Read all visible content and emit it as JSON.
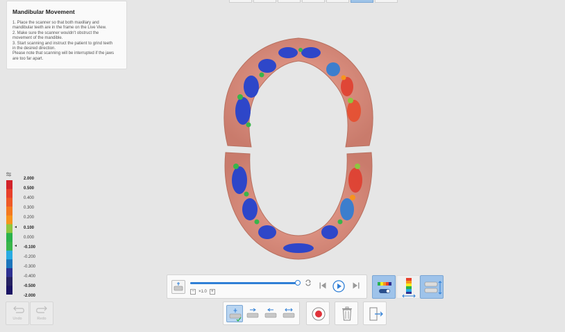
{
  "instructions": {
    "title": "Mandibular Movement",
    "lines": [
      "1. Place the scanner so that both maxillary and",
      "mandibular teeth are in the frame on the Live View.",
      "2. Make sure the scanner wouldn't obstruct the",
      "movement of the mandible.",
      "3. Start scanning and instruct the patient to grind teeth",
      "in the desired direction.",
      "Please note that scanning will be interrupted if the jaws",
      "are too far apart."
    ]
  },
  "color_scale": {
    "labels": [
      "2.000",
      "0.500",
      "0.400",
      "0.300",
      "0.200",
      "0.100",
      "0.000",
      "-0.100",
      "-0.200",
      "-0.300",
      "-0.400",
      "-0.500",
      "-2.000"
    ],
    "colors": [
      "#d2232a",
      "#e8402b",
      "#ee5a28",
      "#f47920",
      "#f7941d",
      "#8dc63f",
      "#2bb24c",
      "#39b54a",
      "#29abe2",
      "#1c75bc",
      "#2e3192",
      "#262262",
      "#1b1464"
    ],
    "bold_labels": [
      "2.000",
      "0.500",
      "0.100",
      "-0.100",
      "-0.500",
      "-2.000"
    ]
  },
  "playback": {
    "speed": "×1.0",
    "progress": 1.0
  },
  "undo_redo": {
    "undo_label": "Undo",
    "redo_label": "Redo"
  },
  "icons": {
    "scan": "scan-mode-icon",
    "loop": "loop-icon",
    "prev": "skip-back-icon",
    "play": "play-icon",
    "next": "skip-forward-icon",
    "colormap": "color-map-toggle-icon",
    "scale": "color-scale-icon",
    "jaw": "jaw-view-icon",
    "record": "record-icon",
    "trash": "trash-icon",
    "exit": "exit-icon"
  },
  "accent": "#2f7fd6"
}
